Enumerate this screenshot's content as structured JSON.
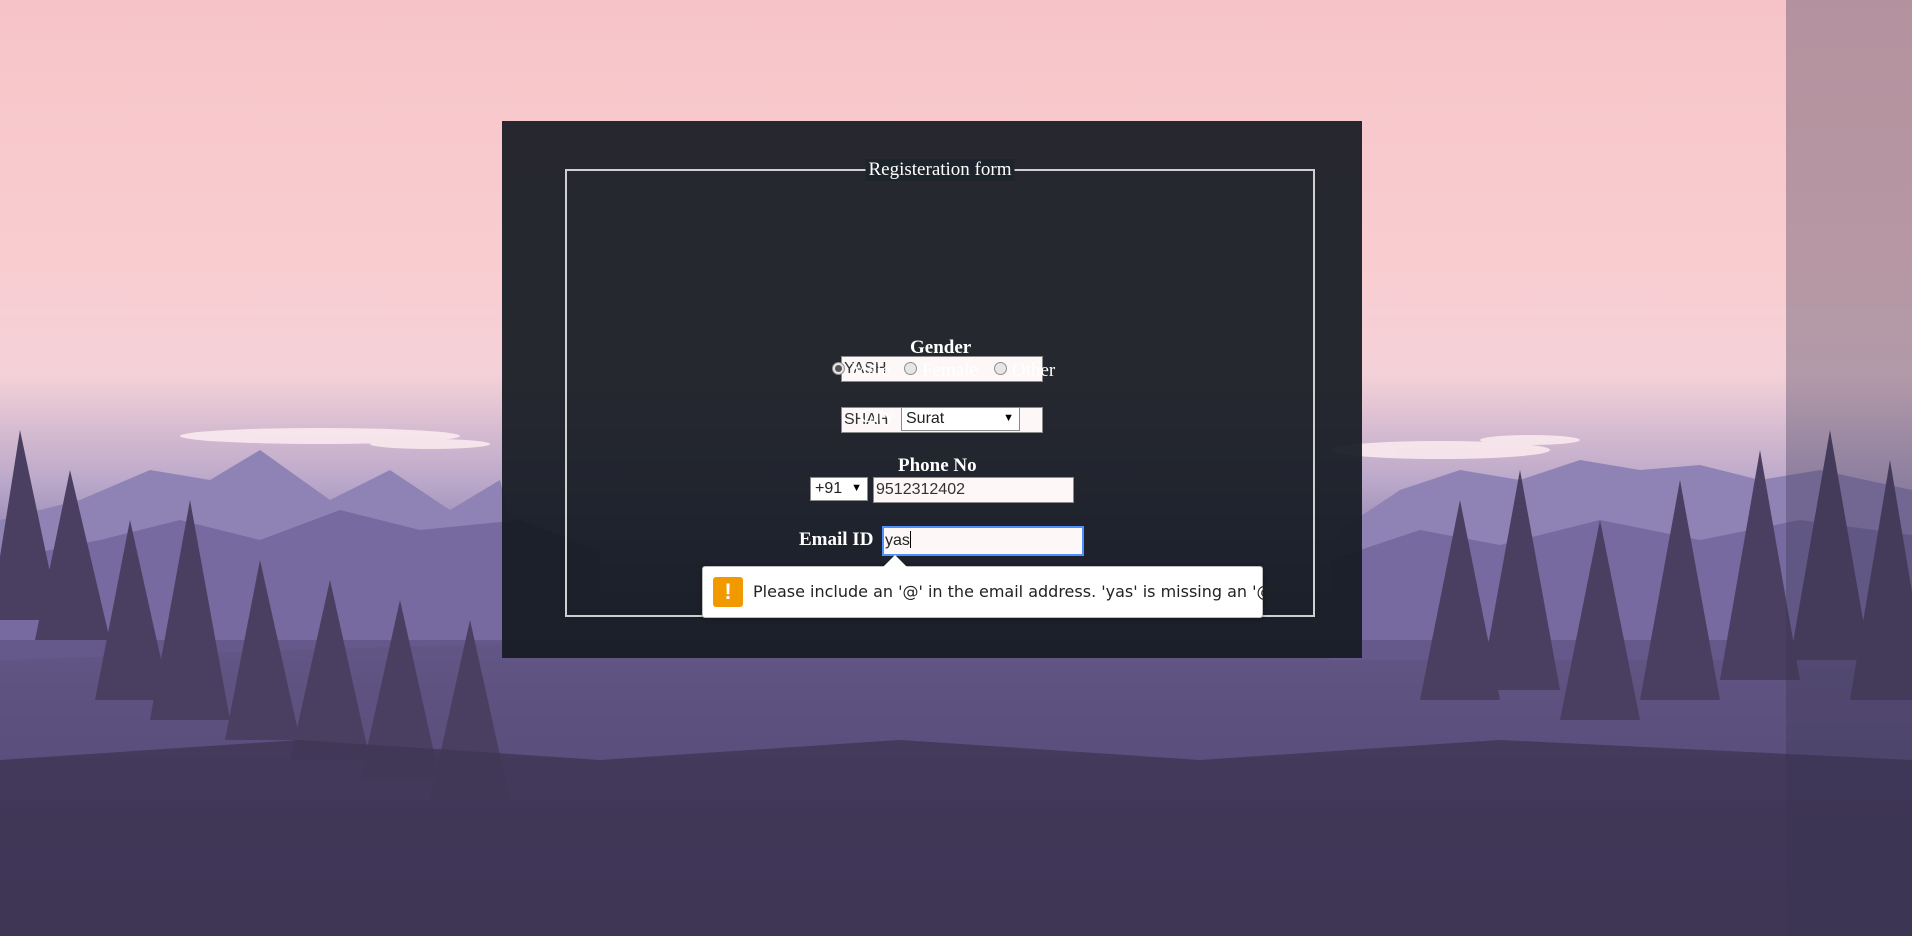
{
  "form": {
    "legend": "Registeration form",
    "first_name": "YASH",
    "last_name": "SHAH",
    "gender_label": "Gender",
    "gender_options": [
      "Male",
      "Female",
      "Other"
    ],
    "gender_selected": "Male",
    "city_label": "City",
    "city_value": "Surat",
    "phone_label": "Phone No",
    "phone_code": "+91",
    "phone_number": "9512312402",
    "email_label": "Email ID",
    "email_value": "yas"
  },
  "validation": {
    "icon": "warning-icon",
    "message": "Please include an '@' in the email address. 'yas' is missing an '@'."
  },
  "colors": {
    "panel": "#161b22",
    "focus_border": "#4d90fe",
    "warning": "#f29900"
  }
}
